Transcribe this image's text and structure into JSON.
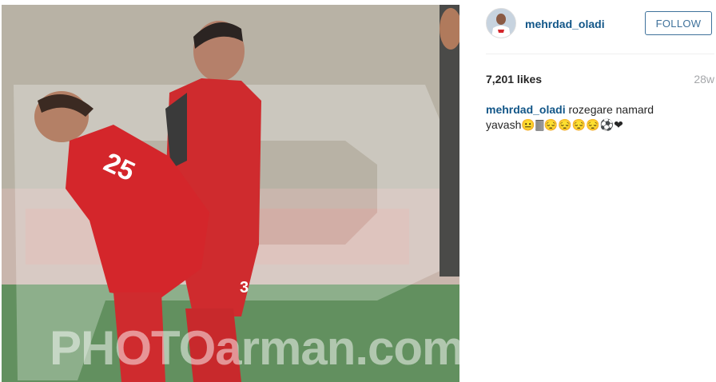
{
  "post": {
    "photo_watermark": "PHOTOarman.com",
    "photo_overlay_text": "P",
    "jersey_numbers": [
      "25",
      "3"
    ]
  },
  "header": {
    "username": "mehrdad_oladi",
    "follow_label": "FOLLOW"
  },
  "stats": {
    "likes": "7,201 likes",
    "age": "28w"
  },
  "caption": {
    "username": "mehrdad_oladi",
    "text": "rozegare namard yavash😐🀫😔😔😔😔⚽❤"
  },
  "colors": {
    "link": "#125688",
    "follow_border": "#3f729b",
    "jersey_red": "#d4262b",
    "pitch_green": "#5d8a5d"
  }
}
